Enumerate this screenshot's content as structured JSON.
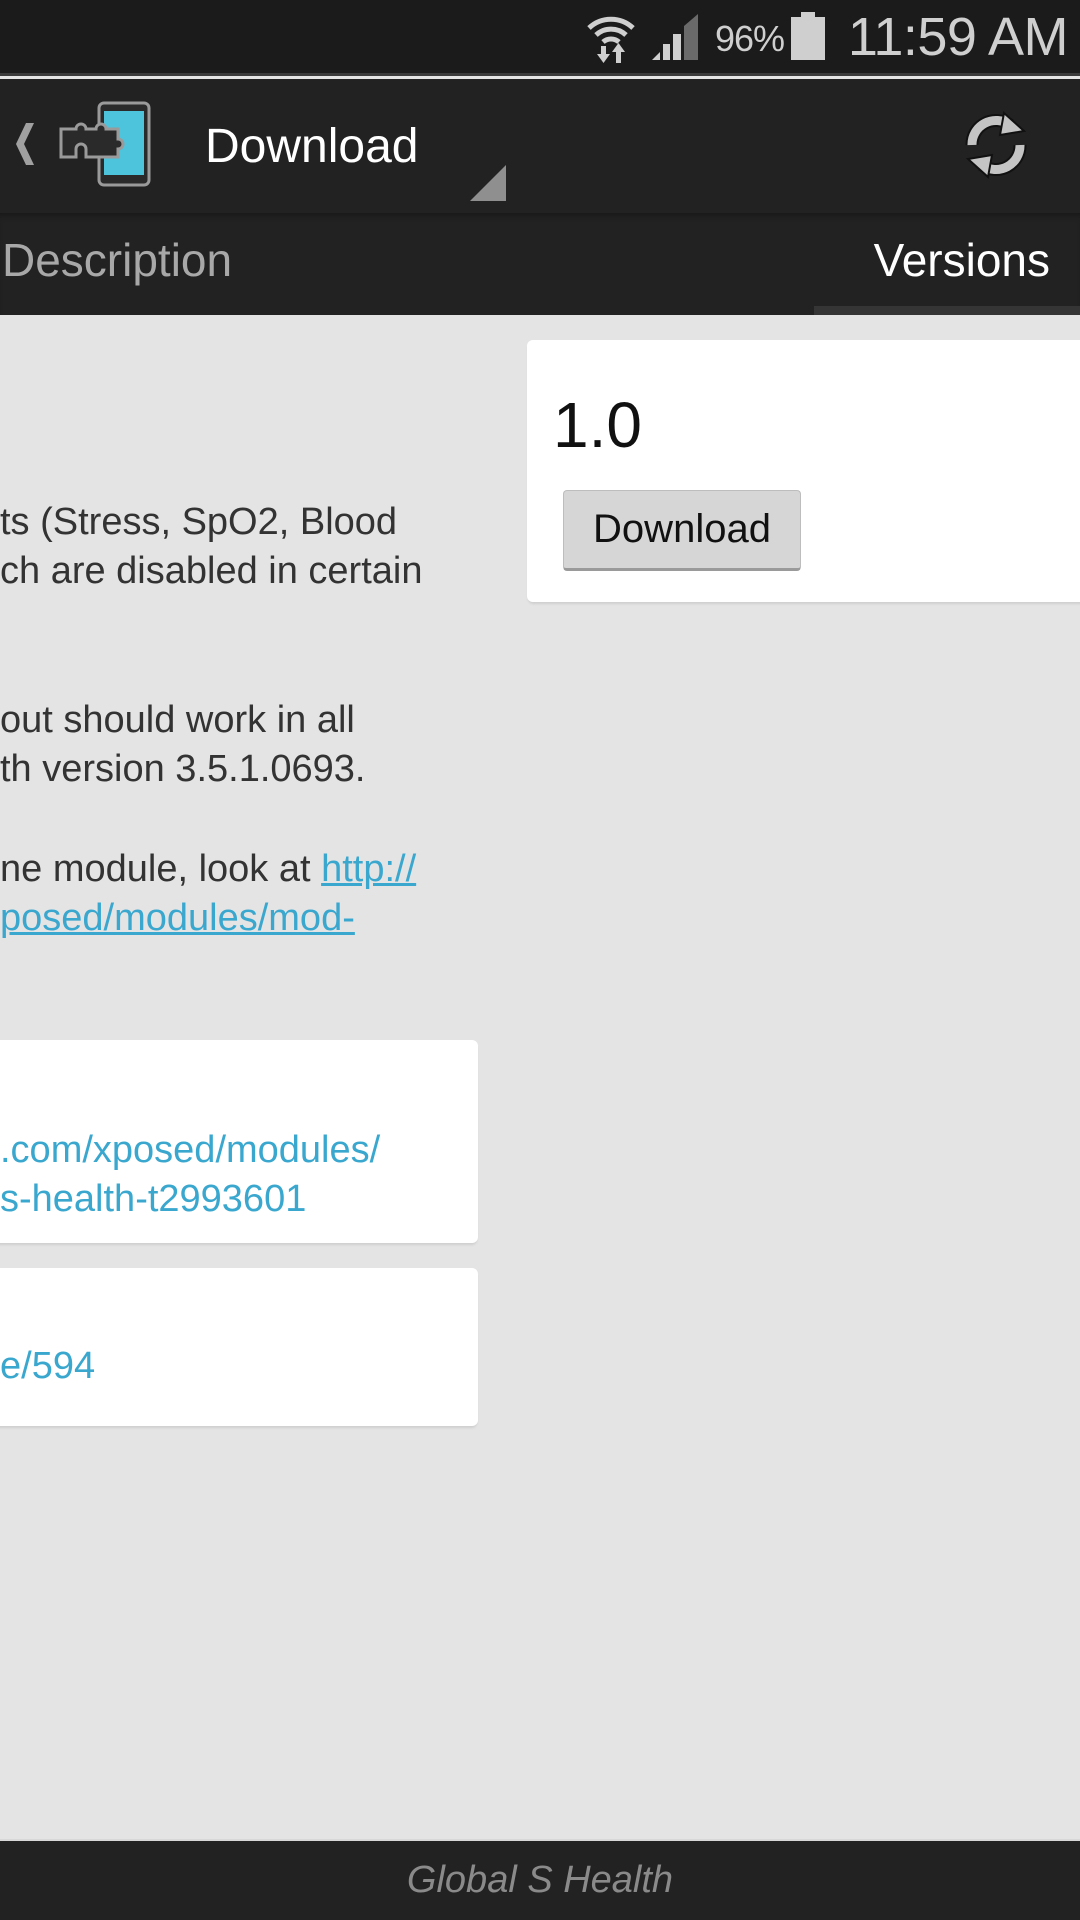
{
  "status_bar": {
    "wifi_icon": "wifi-data-transfer-icon",
    "signal_icon": "cell-signal-icon",
    "battery_percent": "96%",
    "battery_icon": "battery-icon",
    "time": "11:59 AM"
  },
  "action_bar": {
    "up_icon": "chevron-left-icon",
    "app_icon": "xposed-puzzle-phone-icon",
    "title": "Download",
    "refresh_icon": "refresh-icon"
  },
  "tabs": [
    {
      "label": "Description",
      "active": false
    },
    {
      "label": "Versions",
      "active": true
    }
  ],
  "description": {
    "paragraph1": [
      "ts (Stress, SpO2, Blood",
      "ch are disabled in certain"
    ],
    "paragraph2": [
      "out should work in all",
      "th version 3.5.1.0693."
    ],
    "paragraph3_text": "ne module, look at ",
    "paragraph3_link_line1": "http://",
    "paragraph3_link_line2": "posed/modules/mod-"
  },
  "support_card": {
    "lines": [
      ".com/xposed/modules/",
      "s-health-t2993601"
    ]
  },
  "source_card": {
    "lines": [
      "e/594"
    ]
  },
  "versions": [
    {
      "name": "1.0",
      "download_label": "Download"
    }
  ],
  "bottom_bar": {
    "module_name": "Global S Health"
  },
  "colors": {
    "accent_link": "#3aa7cf",
    "bar_background": "#222222",
    "content_background": "#e4e4e4"
  }
}
